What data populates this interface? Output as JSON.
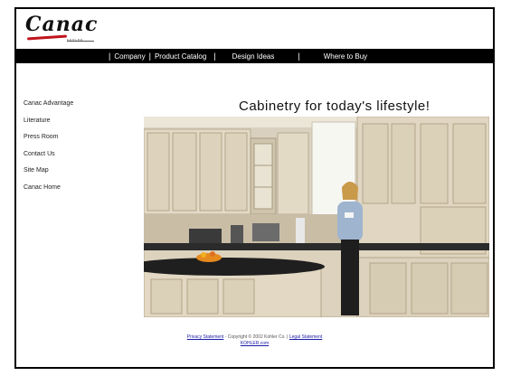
{
  "logo": {
    "brand": "Canac",
    "subtext": "KOHLER"
  },
  "nav": {
    "items": [
      "Company",
      "Product Catalog",
      "Design Ideas",
      "Where to Buy"
    ]
  },
  "sidebar": {
    "items": [
      "Canac Advantage",
      "Literature",
      "Press Room",
      "Contact Us",
      "Site Map",
      "Canac Home"
    ]
  },
  "main": {
    "tagline": "Cabinetry for today's lifestyle!",
    "image_desc": "kitchen-photo"
  },
  "footer": {
    "privacy": "Privacy Statement",
    "copyright": "· Copyright © 2002 Kohler Co. |",
    "legal": "Legal Statement",
    "site": "KOHLER.com"
  },
  "colors": {
    "nav_bg": "#000000",
    "link": "#1a1aa6",
    "brand_accent": "#c0141e"
  }
}
